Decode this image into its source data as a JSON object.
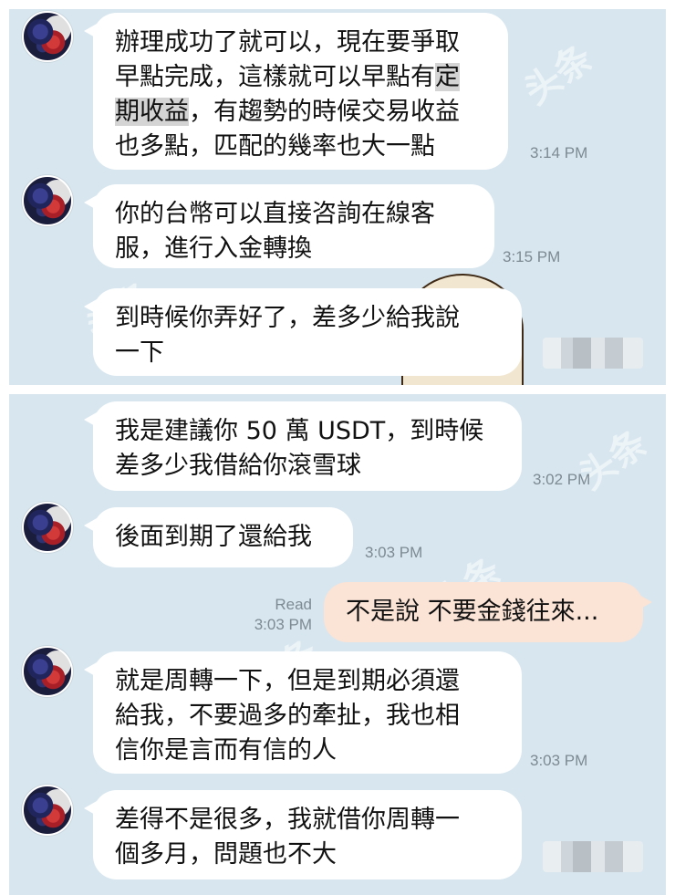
{
  "top_panel": {
    "messages": [
      {
        "direction": "incoming",
        "text_before": "辦理成功了就可以，現在要爭取\n早點完成，這樣就可以早點有",
        "highlight_1": "定",
        "text_mid": "\n",
        "highlight_2": "期收益",
        "text_after": "，有趨勢的時候交易收益\n也多點，匹配的幾率也大一點",
        "time": "3:14 PM"
      },
      {
        "direction": "incoming",
        "text": "你的台幣可以直接咨詢在線客\n服，進行入金轉換",
        "time": "3:15 PM"
      },
      {
        "direction": "incoming",
        "text": "到時候你弄好了，差多少給我說\n一下",
        "time": ""
      }
    ]
  },
  "bottom_panel": {
    "messages": [
      {
        "direction": "incoming",
        "text": "我是建議你 50 萬 USDT，到時候\n差多少我借給你滾雪球",
        "time": "3:02 PM"
      },
      {
        "direction": "incoming",
        "text": "後面到期了還給我",
        "time": "3:03 PM"
      },
      {
        "direction": "outgoing",
        "text": "不是說 不要金錢往來...",
        "read_label": "Read",
        "time": "3:03 PM"
      },
      {
        "direction": "incoming",
        "text": "就是周轉一下，但是到期必須還\n給我，不要過多的牽扯，我也相\n信你是言而有信的人",
        "time": "3:03 PM"
      },
      {
        "direction": "incoming",
        "text": "差得不是很多，我就借你周轉一\n個多月，問題也不大",
        "time": ""
      }
    ]
  },
  "colors": {
    "chat_background": "#d8e6ef",
    "incoming_bubble": "#ffffff",
    "outgoing_bubble": "#fbe3d6",
    "timestamp": "#7d8a93",
    "highlight": "#d4d4d4"
  },
  "icons": {
    "avatar": "fruit-bowl-avatar-icon",
    "sticker": "giraffe-sticker-icon"
  }
}
